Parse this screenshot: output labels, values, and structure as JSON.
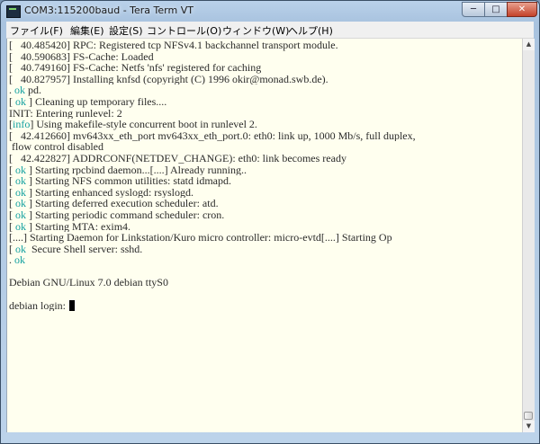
{
  "window": {
    "title": "COM3:115200baud - Tera Term VT",
    "minimize_glyph": "─",
    "maximize_glyph": "□",
    "close_glyph": "✕"
  },
  "menu": [
    {
      "label": "ファイル(F)"
    },
    {
      "label": "編集(E)"
    },
    {
      "label": "設定(S)"
    },
    {
      "label": "コントロール(O)"
    },
    {
      "label": "ウィンドウ(W)"
    },
    {
      "label": "ヘルプ(H)"
    }
  ],
  "terminal": {
    "lines": [
      {
        "parts": [
          [
            "plain",
            "[   40.485420] RPC: Registered tcp NFSv4.1 backchannel transport module."
          ]
        ]
      },
      {
        "parts": [
          [
            "plain",
            "[   40.590683] FS-Cache: Loaded"
          ]
        ]
      },
      {
        "parts": [
          [
            "plain",
            "[   40.749160] FS-Cache: Netfs 'nfs' registered for caching"
          ]
        ]
      },
      {
        "parts": [
          [
            "plain",
            "[   40.827957] Installing knfsd (copyright (C) 1996 okir@monad.swb.de)."
          ]
        ]
      },
      {
        "parts": [
          [
            "plain",
            ". "
          ],
          [
            "tag",
            "ok"
          ],
          [
            "plain",
            " pd."
          ]
        ]
      },
      {
        "parts": [
          [
            "plain",
            "[ "
          ],
          [
            "tag",
            "ok"
          ],
          [
            "plain",
            " ] Cleaning up temporary files...."
          ]
        ]
      },
      {
        "parts": [
          [
            "plain",
            "INIT: Entering runlevel: 2"
          ]
        ]
      },
      {
        "parts": [
          [
            "plain",
            "["
          ],
          [
            "tag",
            "info"
          ],
          [
            "plain",
            "] Using makefile-style concurrent boot in runlevel 2."
          ]
        ]
      },
      {
        "parts": [
          [
            "plain",
            "[   42.412660] mv643xx_eth_port mv643xx_eth_port.0: eth0: link up, 1000 Mb/s, full duplex,"
          ]
        ]
      },
      {
        "parts": [
          [
            "plain",
            " flow control disabled"
          ]
        ]
      },
      {
        "parts": [
          [
            "plain",
            "[   42.422827] ADDRCONF(NETDEV_CHANGE): eth0: link becomes ready"
          ]
        ]
      },
      {
        "parts": [
          [
            "plain",
            "[ "
          ],
          [
            "tag",
            "ok"
          ],
          [
            "plain",
            " ] Starting rpcbind daemon...[....] Already running.."
          ]
        ]
      },
      {
        "parts": [
          [
            "plain",
            "[ "
          ],
          [
            "tag",
            "ok"
          ],
          [
            "plain",
            " ] Starting NFS common utilities: statd idmapd."
          ]
        ]
      },
      {
        "parts": [
          [
            "plain",
            "[ "
          ],
          [
            "tag",
            "ok"
          ],
          [
            "plain",
            " ] Starting enhanced syslogd: rsyslogd."
          ]
        ]
      },
      {
        "parts": [
          [
            "plain",
            "[ "
          ],
          [
            "tag",
            "ok"
          ],
          [
            "plain",
            " ] Starting deferred execution scheduler: atd."
          ]
        ]
      },
      {
        "parts": [
          [
            "plain",
            "[ "
          ],
          [
            "tag",
            "ok"
          ],
          [
            "plain",
            " ] Starting periodic command scheduler: cron."
          ]
        ]
      },
      {
        "parts": [
          [
            "plain",
            "[ "
          ],
          [
            "tag",
            "ok"
          ],
          [
            "plain",
            " ] Starting MTA: exim4."
          ]
        ]
      },
      {
        "parts": [
          [
            "plain",
            "[....] Starting Daemon for Linkstation/Kuro micro controller: micro-evtd[....] Starting Op"
          ]
        ]
      },
      {
        "parts": [
          [
            "plain",
            "[ "
          ],
          [
            "tag",
            "ok"
          ],
          [
            "plain",
            "  Secure Shell server: sshd."
          ]
        ]
      },
      {
        "parts": [
          [
            "plain",
            ". "
          ],
          [
            "tag",
            "ok"
          ]
        ]
      },
      {
        "parts": [
          [
            "plain",
            ""
          ]
        ]
      },
      {
        "parts": [
          [
            "plain",
            "Debian GNU/Linux 7.0 debian ttyS0"
          ]
        ]
      },
      {
        "parts": [
          [
            "plain",
            ""
          ]
        ]
      },
      {
        "parts": [
          [
            "plain",
            "debian login:"
          ]
        ],
        "cursor": true
      }
    ]
  },
  "scrollbar": {
    "up_glyph": "▲",
    "down_glyph": "▼"
  }
}
